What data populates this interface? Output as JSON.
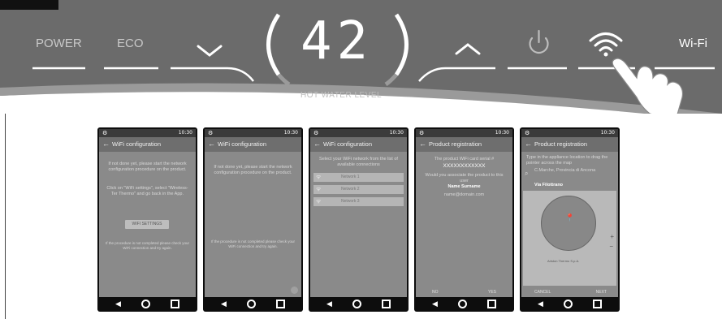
{
  "panel": {
    "power_label": "POWER",
    "eco_label": "ECO",
    "display_value": "42",
    "display_caption": "HOT WATER LEVEL",
    "wifi_label": "Wi-Fi",
    "icons": [
      "chevron-down-icon",
      "chevron-up-icon",
      "power-icon",
      "wifi-icon",
      "hand-pointer-icon"
    ]
  },
  "colors": {
    "panel": "#6b6b6b",
    "panel_dark": "#585858",
    "screen": "#8a8a8a",
    "accent_white": "#ffffff"
  },
  "phones": [
    {
      "status_time": "10:30",
      "title": "WiFi configuration",
      "texts": [
        "If not done yet, please start the network configuration procedure on the product.",
        "Click on \"WiFi settings\", select \"Wireless-Ter Thermo\" and go back in the App."
      ],
      "button": "WIFI SETTINGS",
      "footer": "If the procedure is not completed please check your WiFi connection and try again."
    },
    {
      "status_time": "10:30",
      "title": "WiFi configuration",
      "texts": [
        "If not done yet, please start the network configuration procedure on the product."
      ],
      "footer": "If the procedure is not completed please check your WiFi connection and try again."
    },
    {
      "status_time": "10:30",
      "title": "WiFi configuration",
      "texts": [
        "Select your WiFi network from the list of available connections"
      ],
      "networks": [
        "Network 1",
        "Network 2",
        "Network 3"
      ]
    },
    {
      "status_time": "10:30",
      "title": "Product registration",
      "texts": [
        "The product WiFi card serial #",
        "XXXXXXXXXXXX",
        "Would you associate the product to this user",
        "Name Surname",
        "name@domain.com"
      ],
      "buttons": [
        "NO",
        "YES"
      ]
    },
    {
      "status_time": "10:30",
      "title": "Product registration",
      "texts": [
        "Type in the appliance location to drag the pointer across the map"
      ],
      "location": "C.Marche, Provincia di Ancona",
      "street": "Via Filottrano",
      "map_label": "Ariston Thermo S.p.A.",
      "buttons": [
        "CANCEL",
        "NEXT"
      ]
    }
  ]
}
